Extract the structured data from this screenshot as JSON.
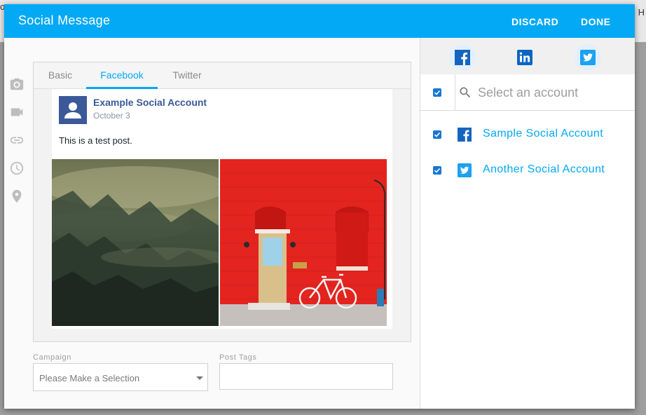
{
  "background": {
    "left_fragment": "o",
    "right_fragment": "H"
  },
  "header": {
    "title": "Social Message",
    "discard_label": "DISCARD",
    "done_label": "DONE"
  },
  "toolbar_icons": [
    "camera-icon",
    "video-icon",
    "link-icon",
    "clock-icon",
    "location-pin-icon"
  ],
  "tabs": [
    {
      "label": "Basic",
      "active": false
    },
    {
      "label": "Facebook",
      "active": true
    },
    {
      "label": "Twitter",
      "active": false
    }
  ],
  "post": {
    "account_name": "Example Social Account",
    "date": "October 3",
    "text": "This is a test post."
  },
  "form": {
    "campaign_label": "Campaign",
    "campaign_value": "Please Make a Selection",
    "tags_label": "Post Tags",
    "tags_value": ""
  },
  "networks": [
    {
      "name": "facebook-icon",
      "selected": true
    },
    {
      "name": "linkedin-icon",
      "selected": false
    },
    {
      "name": "twitter-icon",
      "selected": true
    }
  ],
  "account_search": {
    "placeholder": "Select an account",
    "select_all_checked": true
  },
  "accounts": [
    {
      "label": "Sample Social Account",
      "network": "facebook",
      "checked": true
    },
    {
      "label": "Another Social Account",
      "network": "twitter",
      "checked": true
    }
  ],
  "colors": {
    "header": "#03a9f4",
    "accent": "#03a9f4",
    "facebook": "#3b5998",
    "facebook_icon": "#1565c0",
    "linkedin": "#0a66c2",
    "twitter": "#1da1f2",
    "checkbox": "#1976d2"
  }
}
